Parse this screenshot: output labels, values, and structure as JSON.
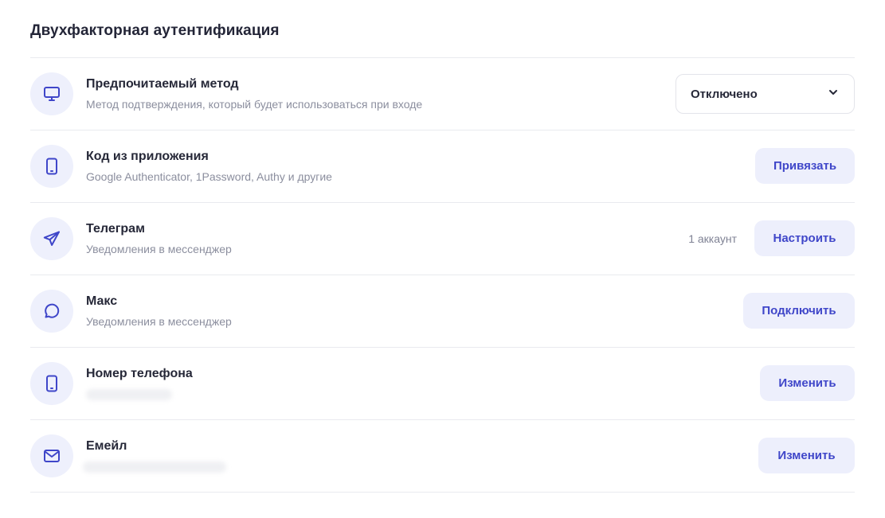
{
  "section": {
    "title": "Двухфакторная аутентификация"
  },
  "colors": {
    "accent": "#3f46c9",
    "icon_bg": "#eef0fc",
    "button_bg": "#edeffc"
  },
  "rows": [
    {
      "icon": "monitor-icon",
      "title": "Предпочитаемый метод",
      "subtitle": "Метод подтверждения, который будет использоваться при входе",
      "select_value": "Отключено"
    },
    {
      "icon": "smartphone-icon",
      "title": "Код из приложения",
      "subtitle": "Google Authenticator, 1Password, Authy и другие",
      "button": "Привязать"
    },
    {
      "icon": "telegram-icon",
      "title": "Телеграм",
      "subtitle": "Уведомления в мессенджер",
      "count": "1 аккаунт",
      "button": "Настроить"
    },
    {
      "icon": "chat-bubble-icon",
      "title": "Макс",
      "subtitle": "Уведомления в мессенджер",
      "button": "Подключить"
    },
    {
      "icon": "smartphone-icon",
      "title": "Номер телефона",
      "button": "Изменить"
    },
    {
      "icon": "mail-icon",
      "title": "Емейл",
      "button": "Изменить"
    }
  ]
}
